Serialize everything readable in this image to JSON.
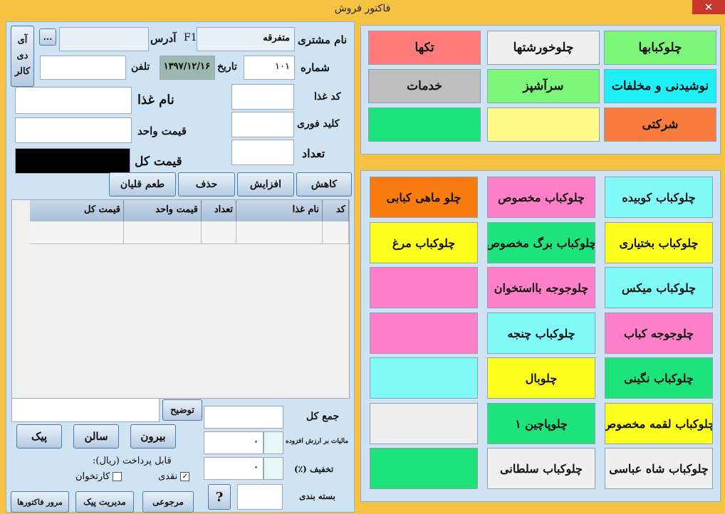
{
  "window": {
    "title": "فاکتور فروش",
    "close_glyph": "✕"
  },
  "customer": {
    "name_label": "نام مشتری",
    "name_value": "متفرقه",
    "f1_label": "F1",
    "address_label": "آدرس",
    "address_value": "",
    "more_label": "...",
    "id_caller_label": "آی دی کالر",
    "number_label": "شماره",
    "number_value": "۱۰۱",
    "date_label": "تاریخ",
    "date_value": "۱۳۹۷/۱۲/۱۶",
    "phone_label": "تلفن",
    "phone_value": ""
  },
  "item": {
    "code_label": "کد غذا",
    "code_value": "",
    "hotkey_label": "کلید فوری",
    "hotkey_value": "",
    "qty_label": "تعداد",
    "qty_value": "",
    "food_name_label": "نام غذا",
    "food_name_value": "",
    "unit_price_label": "قیمت واحد",
    "unit_price_value": "",
    "total_price_label": "قیمت کل",
    "total_price_value": ""
  },
  "actions": {
    "decrease": "کاهش",
    "increase": "افزایش",
    "delete": "حذف",
    "hookah_flavor": "طعم قلیان"
  },
  "grid": {
    "columns": [
      "کد",
      "نام غذا",
      "تعداد",
      "قیمت واحد",
      "قیمت کل"
    ]
  },
  "footer": {
    "description_label": "توضیح",
    "description_value": "",
    "sum_label": "جمع کل",
    "sum_value": "",
    "vat_label": "مالیات بر ارزش افزوده",
    "vat_value": "۰",
    "discount_label": "تخفیف (٪)",
    "discount_value": "۰",
    "packaging_label": "بسته بندی",
    "packaging_value": "",
    "payable_label": "قابل پرداخت (ریال):",
    "cash_label": "نقدی",
    "cash_checked": true,
    "card_label": "کارتخوان",
    "card_checked": false,
    "help_label": "?",
    "order_types": {
      "courier": "پیک",
      "hall": "سالن",
      "takeout": "بیرون"
    },
    "bottom_buttons": {
      "invoice_review": "مرور فاکتورها",
      "courier_management": "مدیریت پیک",
      "return": "مرجوعی"
    }
  },
  "categories": [
    {
      "label": "تکها",
      "color": "#ff7a7a"
    },
    {
      "label": "چلوخورشتها",
      "color": "#efefef"
    },
    {
      "label": "چلوکبابها",
      "color": "#7df77a"
    },
    {
      "label": "خدمات",
      "color": "#bdbdbd"
    },
    {
      "label": "سرآشپز",
      "color": "#7df77a"
    },
    {
      "label": "نوشیدنی و مخلفات",
      "color": "#1ef0f5"
    },
    {
      "label": "",
      "color": "#1de37a"
    },
    {
      "label": "",
      "color": "#fffa8a"
    },
    {
      "label": "شرکتی",
      "color": "#fa7b3e"
    }
  ],
  "foods": [
    {
      "label": "چلو ماهی کبابی",
      "color": "#fa7b10"
    },
    {
      "label": "چلوکباب مخصوص",
      "color": "#ff80c8"
    },
    {
      "label": "چلوکباب کوبیده",
      "color": "#80fbfa"
    },
    {
      "label": "چلوکباب مرغ",
      "color": "#ffff1e"
    },
    {
      "label": "چلوکباب برگ مخصوص",
      "color": "#1ee37a"
    },
    {
      "label": "چلوکباب بختیاری",
      "color": "#ffff1e"
    },
    {
      "label": "",
      "color": "#ff80c8"
    },
    {
      "label": "چلوجوجه بااستخوان",
      "color": "#ff80c8"
    },
    {
      "label": "چلوکباب میکس",
      "color": "#80fbfa"
    },
    {
      "label": "",
      "color": "#ff80c8"
    },
    {
      "label": "چلوکباب چنجه",
      "color": "#80fbfa"
    },
    {
      "label": "چلوجوجه کباب",
      "color": "#ff80c8"
    },
    {
      "label": "",
      "color": "#80fbfa"
    },
    {
      "label": "چلوبال",
      "color": "#ffff1e"
    },
    {
      "label": "چلوکباب نگینی",
      "color": "#1ee37a"
    },
    {
      "label": "",
      "color": "#efefef"
    },
    {
      "label": "چلوپاچین ۱",
      "color": "#1ee37a"
    },
    {
      "label": "چلوکباب لقمه مخصوص",
      "color": "#ffff1e"
    },
    {
      "label": "",
      "color": "#1ee37a"
    },
    {
      "label": "چلوکباب سلطانی",
      "color": "#efefef"
    },
    {
      "label": "چلوکباب شاه عباسی",
      "color": "#efefef"
    }
  ]
}
